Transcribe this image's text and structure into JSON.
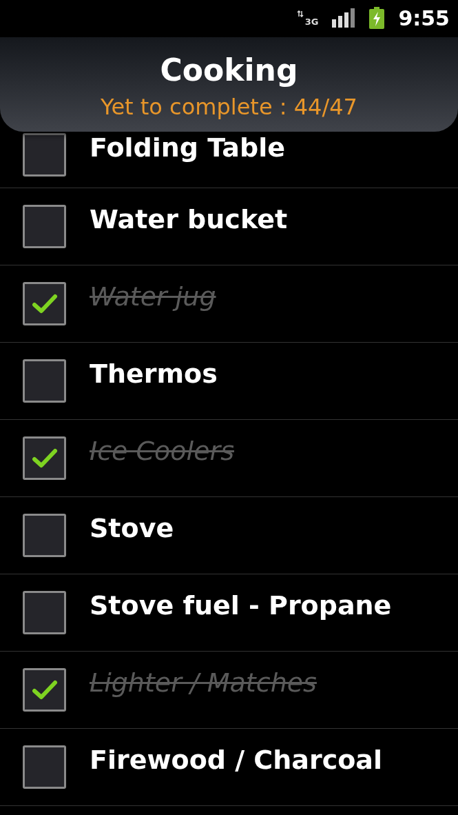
{
  "status_bar": {
    "network": "3G",
    "time": "9:55"
  },
  "header": {
    "title": "Cooking",
    "subtitle": "Yet to complete : 44/47"
  },
  "items": [
    {
      "label": "Folding Table",
      "checked": false
    },
    {
      "label": "Water bucket",
      "checked": false
    },
    {
      "label": "Water jug",
      "checked": true
    },
    {
      "label": "Thermos",
      "checked": false
    },
    {
      "label": "Ice Coolers",
      "checked": true
    },
    {
      "label": "Stove",
      "checked": false
    },
    {
      "label": "Stove fuel - Propane",
      "checked": false
    },
    {
      "label": "Lighter / Matches",
      "checked": true
    },
    {
      "label": "Firewood / Charcoal",
      "checked": false
    }
  ]
}
